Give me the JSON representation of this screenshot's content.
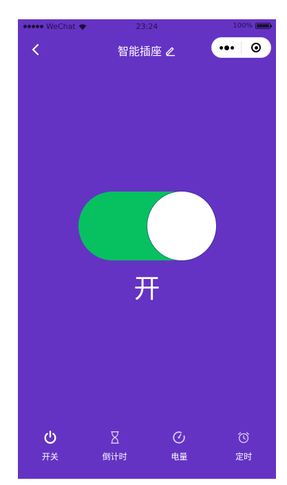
{
  "status_bar": {
    "carrier": "WeChat",
    "time": "23:24",
    "battery_text": "100%"
  },
  "nav": {
    "title": "智能插座",
    "back_icon": "chevron-left-icon",
    "edit_icon": "pencil-icon",
    "capsule_more_icon": "more-dots-icon",
    "capsule_close_icon": "target-close-icon"
  },
  "switch": {
    "is_on": true,
    "state_label": "开",
    "on_color": "#07c160"
  },
  "colors": {
    "background": "#6533c4",
    "text": "#ffffff"
  },
  "tabs": [
    {
      "label": "开关",
      "icon": "power-icon"
    },
    {
      "label": "倒计时",
      "icon": "hourglass-icon"
    },
    {
      "label": "电量",
      "icon": "gauge-icon"
    },
    {
      "label": "定时",
      "icon": "alarm-clock-icon"
    }
  ]
}
